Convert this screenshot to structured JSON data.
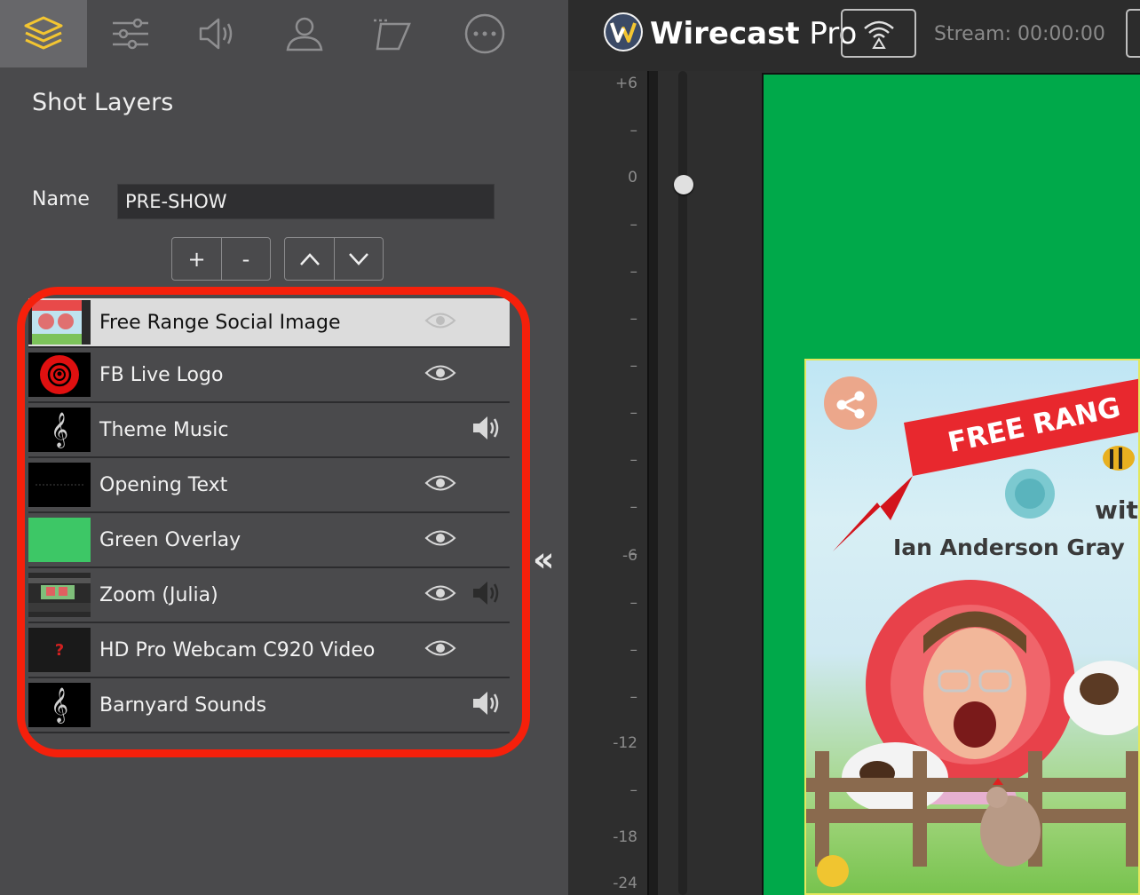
{
  "toolbar": {
    "tools": [
      "layers-icon",
      "sliders-icon",
      "audio-icon",
      "user-icon",
      "transition-icon",
      "more-icon"
    ]
  },
  "panel": {
    "title": "Shot Layers",
    "name_label": "Name",
    "name_value": "PRE-SHOW",
    "add_label": "+",
    "remove_label": "-"
  },
  "layers": [
    {
      "name": "Free Range Social Image",
      "visible_icon": "eye",
      "audio_icon": ""
    },
    {
      "name": "FB Live Logo",
      "visible_icon": "eye",
      "audio_icon": ""
    },
    {
      "name": "Theme Music",
      "visible_icon": "",
      "audio_icon": "speaker"
    },
    {
      "name": "Opening Text",
      "visible_icon": "eye",
      "audio_icon": ""
    },
    {
      "name": "Green Overlay",
      "visible_icon": "eye",
      "audio_icon": ""
    },
    {
      "name": "Zoom (Julia)",
      "visible_icon": "eye",
      "audio_icon": "speaker"
    },
    {
      "name": "HD Pro Webcam C920 Video",
      "visible_icon": "eye",
      "audio_icon": ""
    },
    {
      "name": "Barnyard Sounds",
      "visible_icon": "",
      "audio_icon": "speaker"
    }
  ],
  "header": {
    "app_name": "Wirecast",
    "app_edition": "Pro",
    "stream_label": "Stream:",
    "stream_time": "00:00:00"
  },
  "meter": {
    "ticks": [
      "+6",
      "–",
      "0",
      "–",
      "–",
      "–",
      "–",
      "–",
      "–",
      "–",
      "–",
      "-6",
      "–",
      "–",
      "–",
      "-12",
      "–",
      "-18",
      "-24"
    ]
  },
  "preview": {
    "overlay_text_1": "FREE RANG",
    "overlay_text_2": "wit",
    "overlay_text_3": "Ian Anderson Gray"
  },
  "colors": {
    "highlight": "#f5200b",
    "preview_bg": "#00a94a",
    "panel_bg": "#4a4a4c"
  }
}
